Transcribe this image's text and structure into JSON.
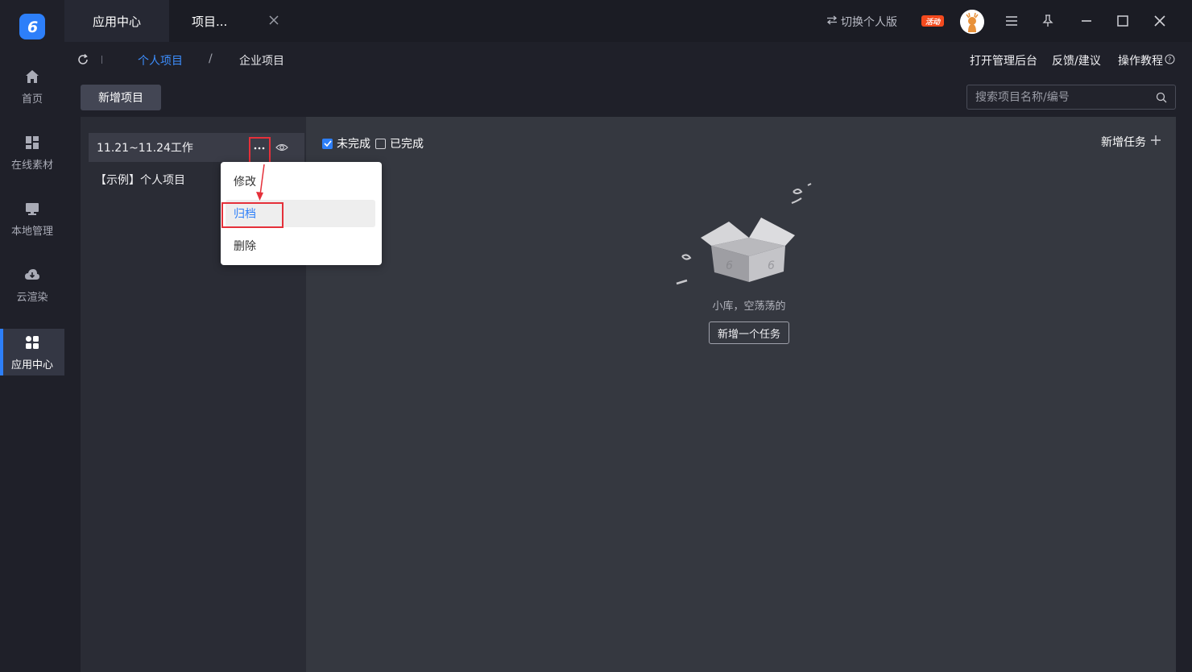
{
  "rail": {
    "items": [
      {
        "label": "首页",
        "icon": "home-icon"
      },
      {
        "label": "在线素材",
        "icon": "grid-icon"
      },
      {
        "label": "本地管理",
        "icon": "monitor-icon"
      },
      {
        "label": "云渲染",
        "icon": "cloud-icon"
      },
      {
        "label": "应用中心",
        "icon": "apps-icon"
      }
    ]
  },
  "titlebar": {
    "tab1": "应用中心",
    "tab2": "项目...",
    "switch_label": "切换个人版",
    "event_badge": "活动"
  },
  "subbar": {
    "crumb_personal": "个人项目",
    "crumb_slash": "/",
    "crumb_enterprise": "企业项目",
    "link_admin": "打开管理后台",
    "link_feedback": "反馈/建议",
    "link_tutorial": "操作教程"
  },
  "toolbar": {
    "add_project": "新增项目",
    "search_placeholder": "搜索项目名称/编号"
  },
  "projects": [
    {
      "name": "11.21~11.24工作",
      "selected": true
    },
    {
      "name": "【示例】个人项目",
      "selected": false
    }
  ],
  "context_menu": {
    "items": [
      "修改",
      "归档",
      "删除"
    ],
    "highlighted": "归档"
  },
  "tasks": {
    "filter_incomplete": "未完成",
    "filter_complete": "已完成",
    "incomplete_checked": true,
    "complete_checked": false,
    "add_task": "新增任务",
    "empty_text": "小库，空荡荡的",
    "empty_button": "新增一个任务"
  },
  "colors": {
    "accent": "#2d7ff9",
    "highlight_box": "#e5303a",
    "event_badge": "#f44a1e"
  }
}
